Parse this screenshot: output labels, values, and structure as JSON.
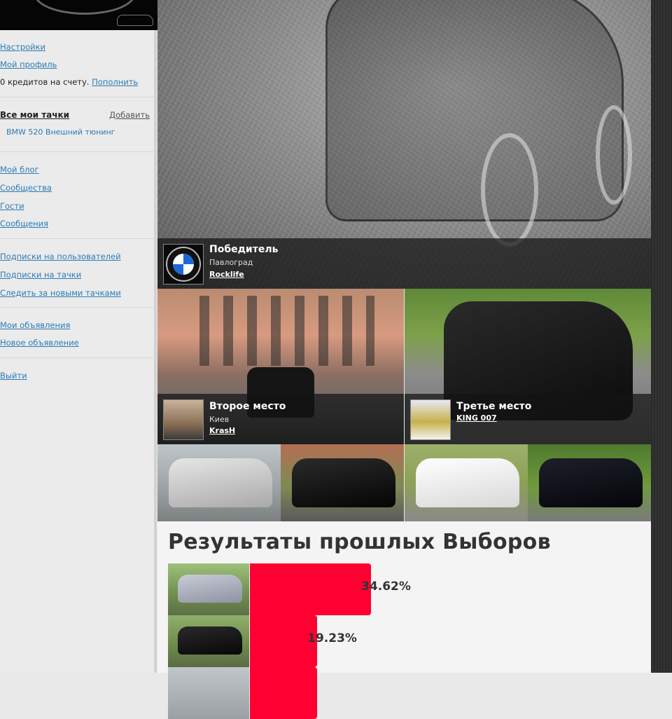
{
  "sidebar": {
    "settings": "Настройки",
    "profile": "Мой профиль",
    "credits_text": "0 кредитов на счету.",
    "top_up": "Пополнить",
    "my_cars_heading": "Все мои тачки",
    "add_label": "Добавить",
    "car_item": "BMW 520 Внешний тюнинг",
    "blog": "Мой блог",
    "communities": "Сообщества",
    "guests": "Гости",
    "messages": "Сообщения",
    "user_subs": "Подписки на пользователей",
    "car_subs": "Подписки на тачки",
    "follow_new": "Следить за новыми тачками",
    "my_ads": "Мои объявления",
    "new_ad": "Новое объявление",
    "logout": "Выйти"
  },
  "winner": {
    "title": "Победитель",
    "city": "Павлоград",
    "user": "Rocklife",
    "icon": "bmw-logo-icon"
  },
  "second": {
    "title": "Второе место",
    "city": "Киев",
    "user": "KrasH"
  },
  "third": {
    "title": "Третье место",
    "user": "KING 007"
  },
  "results": {
    "title": "Результаты прошлых Выборов",
    "rows": [
      {
        "percent": "34.62%",
        "value": 34.62
      },
      {
        "percent": "19.23%",
        "value": 19.23
      },
      {
        "value": 19.23
      }
    ]
  },
  "colors": {
    "accent": "#ff0033",
    "link": "#2a7bb6"
  }
}
